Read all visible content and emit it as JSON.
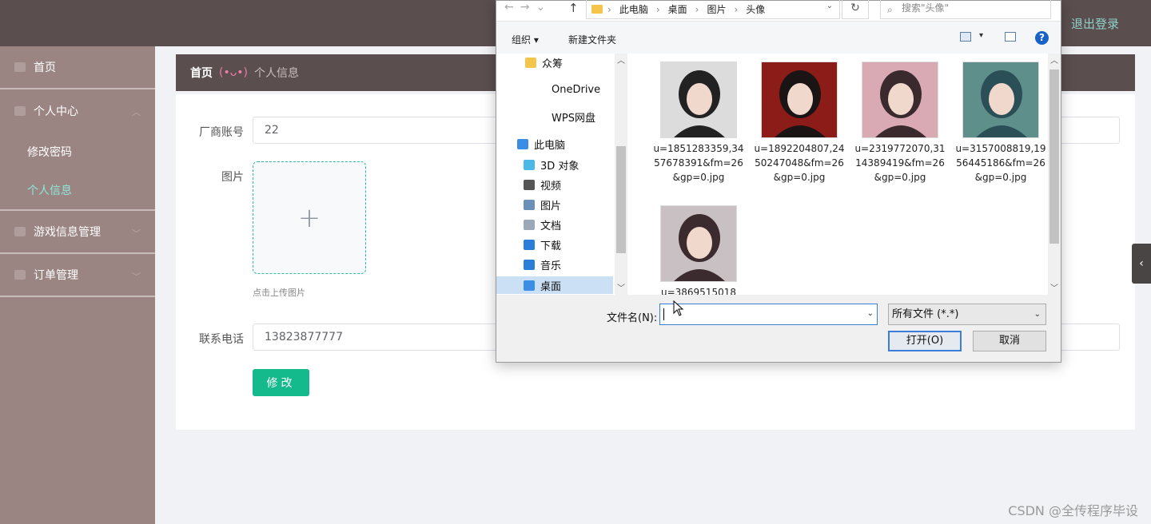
{
  "header": {
    "logout_label": "退出登录"
  },
  "sidebar": {
    "items": [
      {
        "label": "首页"
      },
      {
        "label": "个人中心",
        "children": [
          {
            "label": "修改密码"
          },
          {
            "label": "个人信息"
          }
        ]
      },
      {
        "label": "游戏信息管理"
      },
      {
        "label": "订单管理"
      }
    ]
  },
  "breadcrumb": {
    "home": "首页",
    "face": "(•ᴗ•)",
    "current": "个人信息"
  },
  "form": {
    "account_label": "厂商账号",
    "account_value": "22",
    "image_label": "图片",
    "upload_plus": "+",
    "upload_hint": "点击上传图片",
    "phone_label": "联系电话",
    "phone_value": "13823877777",
    "submit_label": "修改"
  },
  "side_tab_glyph": "‹",
  "watermark": "CSDN @全传程序毕设",
  "dialog": {
    "address": {
      "parts": [
        "此电脑",
        "桌面",
        "图片",
        "头像"
      ]
    },
    "search_placeholder": "搜索\"头像\"",
    "toolbar": {
      "organize": "组织 ▾",
      "new_folder": "新建文件夹",
      "help": "?"
    },
    "tree": [
      {
        "label": "众筹",
        "icon": "folder-icon",
        "color": "#f3c64b"
      },
      {
        "label": "OneDrive",
        "icon": "cloud-icon",
        "color": "#ffffff"
      },
      {
        "label": "WPS网盘",
        "icon": "cloud-icon",
        "color": "#ffffff"
      },
      {
        "label": "此电脑",
        "icon": "computer-icon",
        "color": "#3a8ee6"
      },
      {
        "label": "3D 对象",
        "icon": "cube-icon",
        "color": "#4bb8e8"
      },
      {
        "label": "视频",
        "icon": "video-icon",
        "color": "#555555"
      },
      {
        "label": "图片",
        "icon": "picture-icon",
        "color": "#6a8fb8"
      },
      {
        "label": "文档",
        "icon": "document-icon",
        "color": "#9aa8b8"
      },
      {
        "label": "下载",
        "icon": "download-icon",
        "color": "#2b7fd8"
      },
      {
        "label": "音乐",
        "icon": "music-icon",
        "color": "#2b7fd8"
      },
      {
        "label": "桌面",
        "icon": "desktop-icon",
        "color": "#3a8ee6"
      }
    ],
    "files": [
      {
        "name": "u=1851283359,3457678391&fm=26&gp=0.jpg",
        "bg": "#dcdcdc",
        "fg": "#222222"
      },
      {
        "name": "u=1892204807,2450247048&fm=26&gp=0.jpg",
        "bg": "#8c1c18",
        "fg": "#1b1414"
      },
      {
        "name": "u=2319772070,3114389419&fm=26&gp=0.jpg",
        "bg": "#d9a9b4",
        "fg": "#3a2a2e"
      },
      {
        "name": "u=3157008819,1956445186&fm=26&gp=0.jpg",
        "bg": "#5e8f8a",
        "fg": "#2a4f57"
      },
      {
        "name": "u=3869515018",
        "bg": "#c9c0c4",
        "fg": "#3b2b2e"
      }
    ],
    "filename_label": "文件名(N):",
    "filename_value": "",
    "filetype": "所有文件 (*.*)",
    "open_label": "打开(O)",
    "cancel_label": "取消"
  }
}
